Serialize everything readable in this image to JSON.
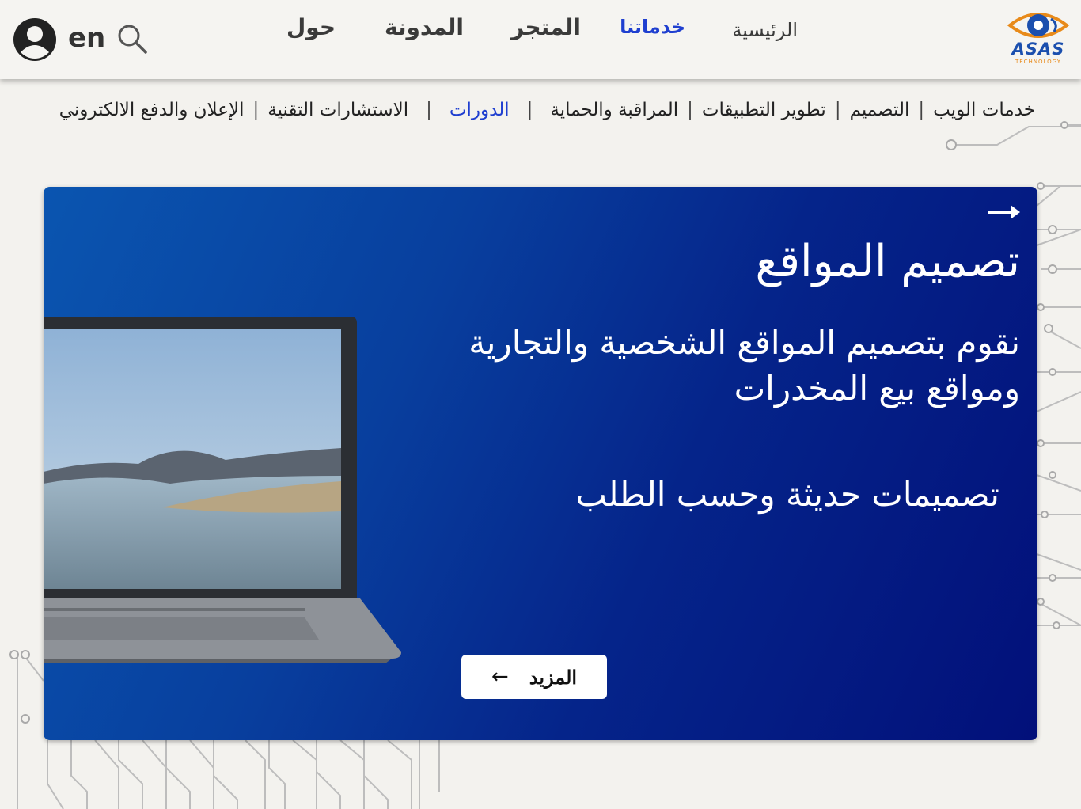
{
  "header": {
    "logo": {
      "name": "ASAS",
      "tagline": "TECHNOLOGY"
    },
    "nav": [
      {
        "label": "الرئيسية",
        "active": false
      },
      {
        "label": "خدماتنا",
        "active": true
      },
      {
        "label": "المتجر",
        "active": false
      },
      {
        "label": "المدونة",
        "active": false
      },
      {
        "label": "حول",
        "active": false
      }
    ],
    "language": "en",
    "icons": {
      "search": "search-icon",
      "user": "user-icon"
    }
  },
  "subnav": {
    "items": [
      {
        "label": "خدمات الويب",
        "active": false
      },
      {
        "label": "التصميم",
        "active": false
      },
      {
        "label": "تطوير التطبيقات",
        "active": false
      },
      {
        "label": "المراقبة والحماية",
        "active": false
      },
      {
        "label": "الدورات",
        "active": true
      },
      {
        "label": "الاستشارات التقنية",
        "active": false
      },
      {
        "label": "الإعلان والدفع الالكتروني",
        "active": false
      }
    ],
    "separator": "|"
  },
  "hero": {
    "title": "تصميم المواقع",
    "description": "نقوم بتصميم المواقع الشخصية والتجارية ومواقع بيع المخدرات",
    "tagline": "تصميمات حديثة وحسب الطلب",
    "button": {
      "label": "المزيد",
      "arrow": "←"
    },
    "image": "laptop-image"
  },
  "colors": {
    "accent": "#1f3fd0",
    "hero_start": "#0a55b0",
    "hero_end": "#02107a",
    "background": "#f3f2ee"
  }
}
